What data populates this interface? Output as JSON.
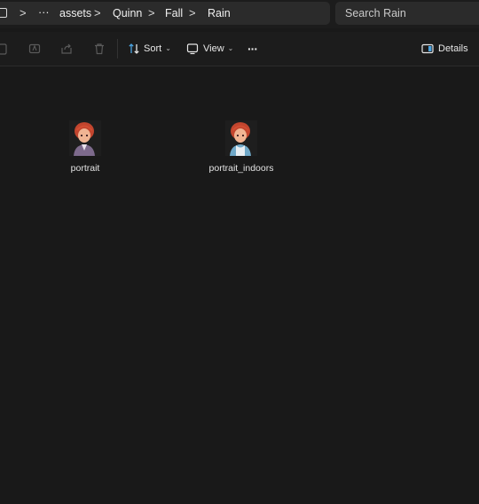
{
  "breadcrumb": {
    "overflow": "···",
    "items": [
      "assets",
      "Quinn",
      "Fall",
      "Rain"
    ],
    "separator": ">"
  },
  "search": {
    "placeholder": "Search Rain"
  },
  "toolbar": {
    "sort_label": "Sort",
    "view_label": "View",
    "more_label": "···",
    "details_label": "Details"
  },
  "files": [
    {
      "name": "portrait"
    },
    {
      "name": "portrait_indoors"
    }
  ],
  "colors": {
    "background": "#191919",
    "accent": "#4aa3e0"
  }
}
